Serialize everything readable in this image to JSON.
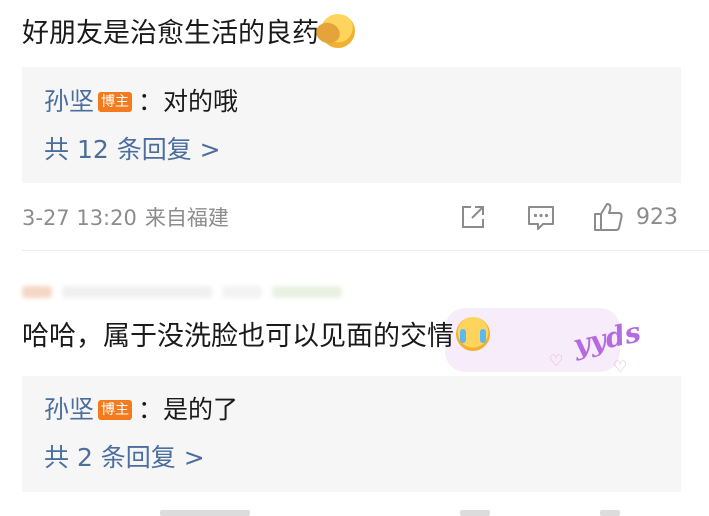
{
  "comment1": {
    "text": "好朋友是治愈生活的良药",
    "emoji": "hug-emoji",
    "reply": {
      "user": "孙坚",
      "badge": "博主",
      "separator": "：",
      "text": "对的哦"
    },
    "more_replies": "共 12 条回复 >"
  },
  "meta": {
    "date": "3-27 13:20",
    "location": "来自福建",
    "like_count": "923"
  },
  "comment2": {
    "text": "哈哈，属于没洗脸也可以见面的交情",
    "emoji": "crying-face-emoji",
    "sticker_text": "yyds",
    "reply": {
      "user": "孙坚",
      "badge": "博主",
      "separator": "：",
      "text": "是的了"
    },
    "more_replies": "共 2 条回复 >"
  },
  "colors": {
    "link": "#4b6e9e",
    "badge": "#f37b1d",
    "meta_gray": "#8c8c8c",
    "reply_bg": "#f6f6f6"
  }
}
